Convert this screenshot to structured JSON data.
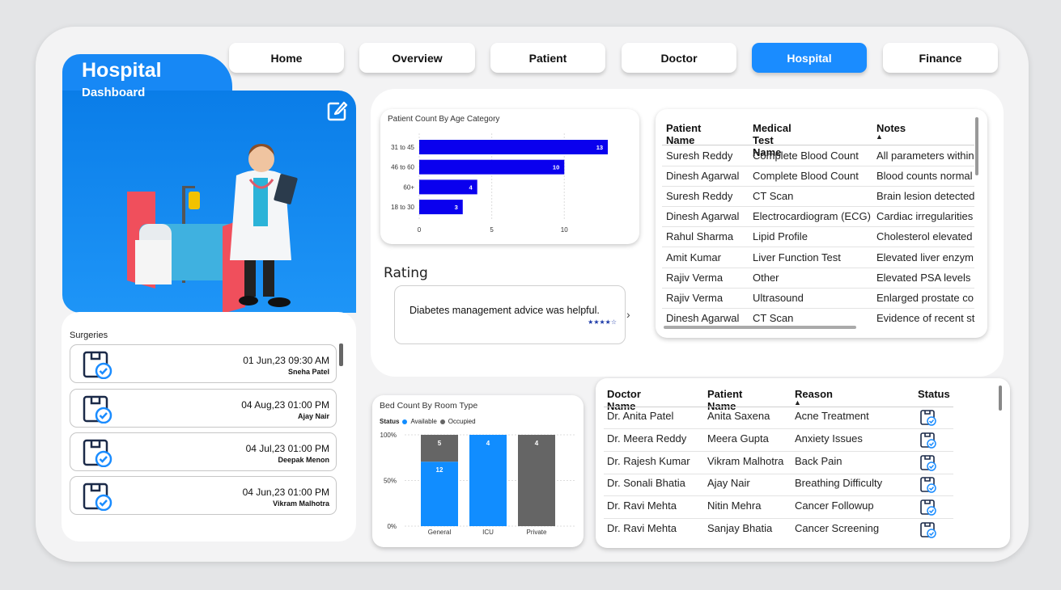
{
  "nav": {
    "items": [
      {
        "label": "Home"
      },
      {
        "label": "Overview"
      },
      {
        "label": "Patient"
      },
      {
        "label": "Doctor"
      },
      {
        "label": "Hospital"
      },
      {
        "label": "Finance"
      }
    ],
    "active": "Hospital"
  },
  "hero": {
    "title": "Hospital",
    "subtitle": "Dashboard",
    "accent": "#1788f5"
  },
  "surgeries": {
    "title": "Surgeries",
    "items": [
      {
        "datetime": "01 Jun,23 09:30 AM",
        "name": "Sneha Patel"
      },
      {
        "datetime": "04 Aug,23 01:00 PM",
        "name": "Ajay Nair"
      },
      {
        "datetime": "04 Jul,23 01:00 PM",
        "name": "Deepak Menon"
      },
      {
        "datetime": "04 Jun,23 01:00 PM",
        "name": "Vikram Malhotra"
      }
    ]
  },
  "age_chart": {
    "chart_data": {
      "type": "bar",
      "orientation": "horizontal",
      "title": "Patient Count By Age Category",
      "categories": [
        "31 to 45",
        "46 to 60",
        "60+",
        "18 to 30"
      ],
      "values": [
        13,
        10,
        4,
        3
      ],
      "xticks": [
        "0",
        "5",
        "10"
      ],
      "xlim": [
        0,
        13.5
      ],
      "color": "#0a00ee"
    }
  },
  "rating": {
    "title": "Rating",
    "text": "Diabetes management advice was helpful.",
    "stars": "★★★★☆",
    "arrow": "›"
  },
  "tests_table": {
    "columns": [
      "Patient Name",
      "Medical Test Name",
      "Notes"
    ],
    "sort_indicator": "▲",
    "rows": [
      [
        "Suresh Reddy",
        "Complete Blood Count",
        "All parameters within"
      ],
      [
        "Dinesh Agarwal",
        "Complete Blood Count",
        "Blood counts normal"
      ],
      [
        "Suresh Reddy",
        "CT Scan",
        "Brain lesion detected"
      ],
      [
        "Dinesh Agarwal",
        "Electrocardiogram (ECG)",
        "Cardiac irregularities"
      ],
      [
        "Rahul Sharma",
        "Lipid Profile",
        "Cholesterol elevated"
      ],
      [
        "Amit Kumar",
        "Liver Function Test",
        "Elevated liver enzym"
      ],
      [
        "Rajiv Verma",
        "Other",
        "Elevated PSA levels"
      ],
      [
        "Rajiv Verma",
        "Ultrasound",
        "Enlarged prostate co"
      ],
      [
        "Dinesh Agarwal",
        "CT Scan",
        "Evidence of recent st"
      ]
    ]
  },
  "bed_chart": {
    "chart_data": {
      "type": "bar",
      "stacked": true,
      "percent": true,
      "title": "Bed Count By Room Type",
      "legend_title": "Status",
      "categories": [
        "General",
        "ICU",
        "Private"
      ],
      "series": [
        {
          "name": "Available",
          "values": [
            12,
            4,
            0
          ],
          "color": "#118dff"
        },
        {
          "name": "Occupied",
          "values": [
            5,
            0,
            4
          ],
          "color": "#656565"
        }
      ],
      "yticks": [
        "100%",
        "50%",
        "0%"
      ]
    }
  },
  "doctor_table": {
    "columns": [
      "Doctor Name",
      "Patient Name",
      "Reason",
      "Status"
    ],
    "sort_indicator": "▲",
    "rows": [
      [
        "Dr. Anita Patel",
        "Anita Saxena",
        "Acne Treatment"
      ],
      [
        "Dr. Meera Reddy",
        "Meera Gupta",
        "Anxiety Issues"
      ],
      [
        "Dr. Rajesh Kumar",
        "Vikram Malhotra",
        "Back Pain"
      ],
      [
        "Dr. Sonali Bhatia",
        "Ajay Nair",
        "Breathing Difficulty"
      ],
      [
        "Dr. Ravi Mehta",
        "Nitin Mehra",
        "Cancer Followup"
      ],
      [
        "Dr. Ravi Mehta",
        "Sanjay Bhatia",
        "Cancer Screening"
      ]
    ]
  }
}
